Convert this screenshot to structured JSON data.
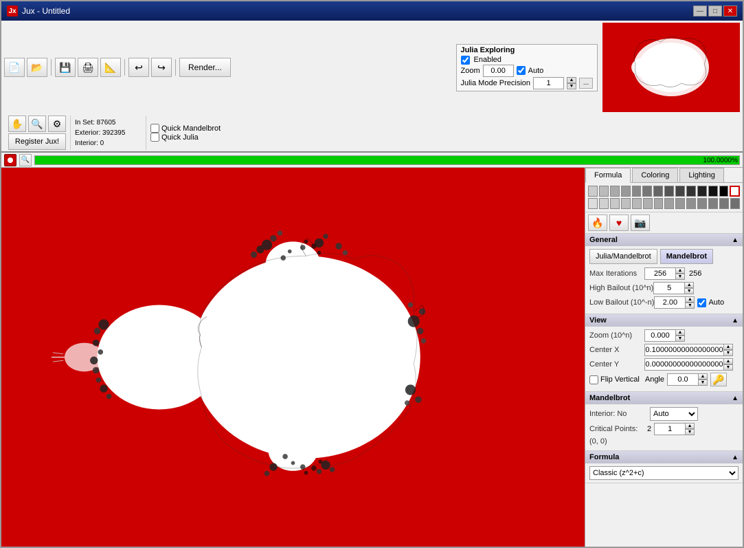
{
  "window": {
    "title": "Jux - Untitled",
    "icon": "Jx"
  },
  "titlebar_buttons": {
    "minimize": "—",
    "maximize": "□",
    "close": "✕"
  },
  "toolbar1": {
    "btns": [
      "📄",
      "💾",
      "🖨",
      "🔍",
      "📐",
      "↩",
      "↪"
    ],
    "render_label": "Render..."
  },
  "toolbar2": {
    "register_label": "Register Jux!",
    "info": {
      "in_set": "In Set: 87605",
      "exterior": "Exterior: 392395",
      "interior": "Interior: 0"
    },
    "quick_mandelbrot": "Quick Mandelbrot",
    "quick_julia": "Quick Julia",
    "julia_section": {
      "title": "Julia Exploring",
      "enabled_label": "Enabled",
      "zoom_label": "Zoom",
      "zoom_value": "0.00",
      "auto_label": "Auto",
      "precision_label": "Julia Mode Precision",
      "precision_value": "1"
    }
  },
  "status": {
    "progress_percent": "100.0000%"
  },
  "tabs": {
    "formula": "Formula",
    "coloring": "Coloring",
    "lighting": "Lighting",
    "active": "formula"
  },
  "color_grid": {
    "rows": 2,
    "cols": 14
  },
  "right_panel": {
    "general_section": {
      "title": "General",
      "julia_mandelbrot_btn": "Julia/Mandelbrot",
      "mandelbrot_btn": "Mandelbrot",
      "max_iterations_label": "Max Iterations",
      "max_iterations_value": "256",
      "max_iterations_display": "256",
      "high_bailout_label": "High Bailout (10^n)",
      "high_bailout_value": "5",
      "low_bailout_label": "Low Bailout (10^-n)",
      "low_bailout_value": "2.00",
      "auto_label": "Auto"
    },
    "view_section": {
      "title": "View",
      "zoom_label": "Zoom (10^n)",
      "zoom_value": "0.000",
      "center_x_label": "Center X",
      "center_x_value": "0.10000000000000000",
      "center_y_label": "Center Y",
      "center_y_value": "0.00000000000000000",
      "flip_vertical_label": "Flip Vertical",
      "angle_label": "Angle",
      "angle_value": "0.0"
    },
    "mandelbrot_section": {
      "title": "Mandelbrot",
      "interior_label": "Interior: No",
      "auto_option": "Auto",
      "critical_points_label": "Critical Points:",
      "critical_points_value": "2",
      "critical_spin_value": "1",
      "coords": "(0, 0)"
    },
    "formula_section": {
      "title": "Formula",
      "formula_value": "Classic (z^2+c)"
    }
  }
}
